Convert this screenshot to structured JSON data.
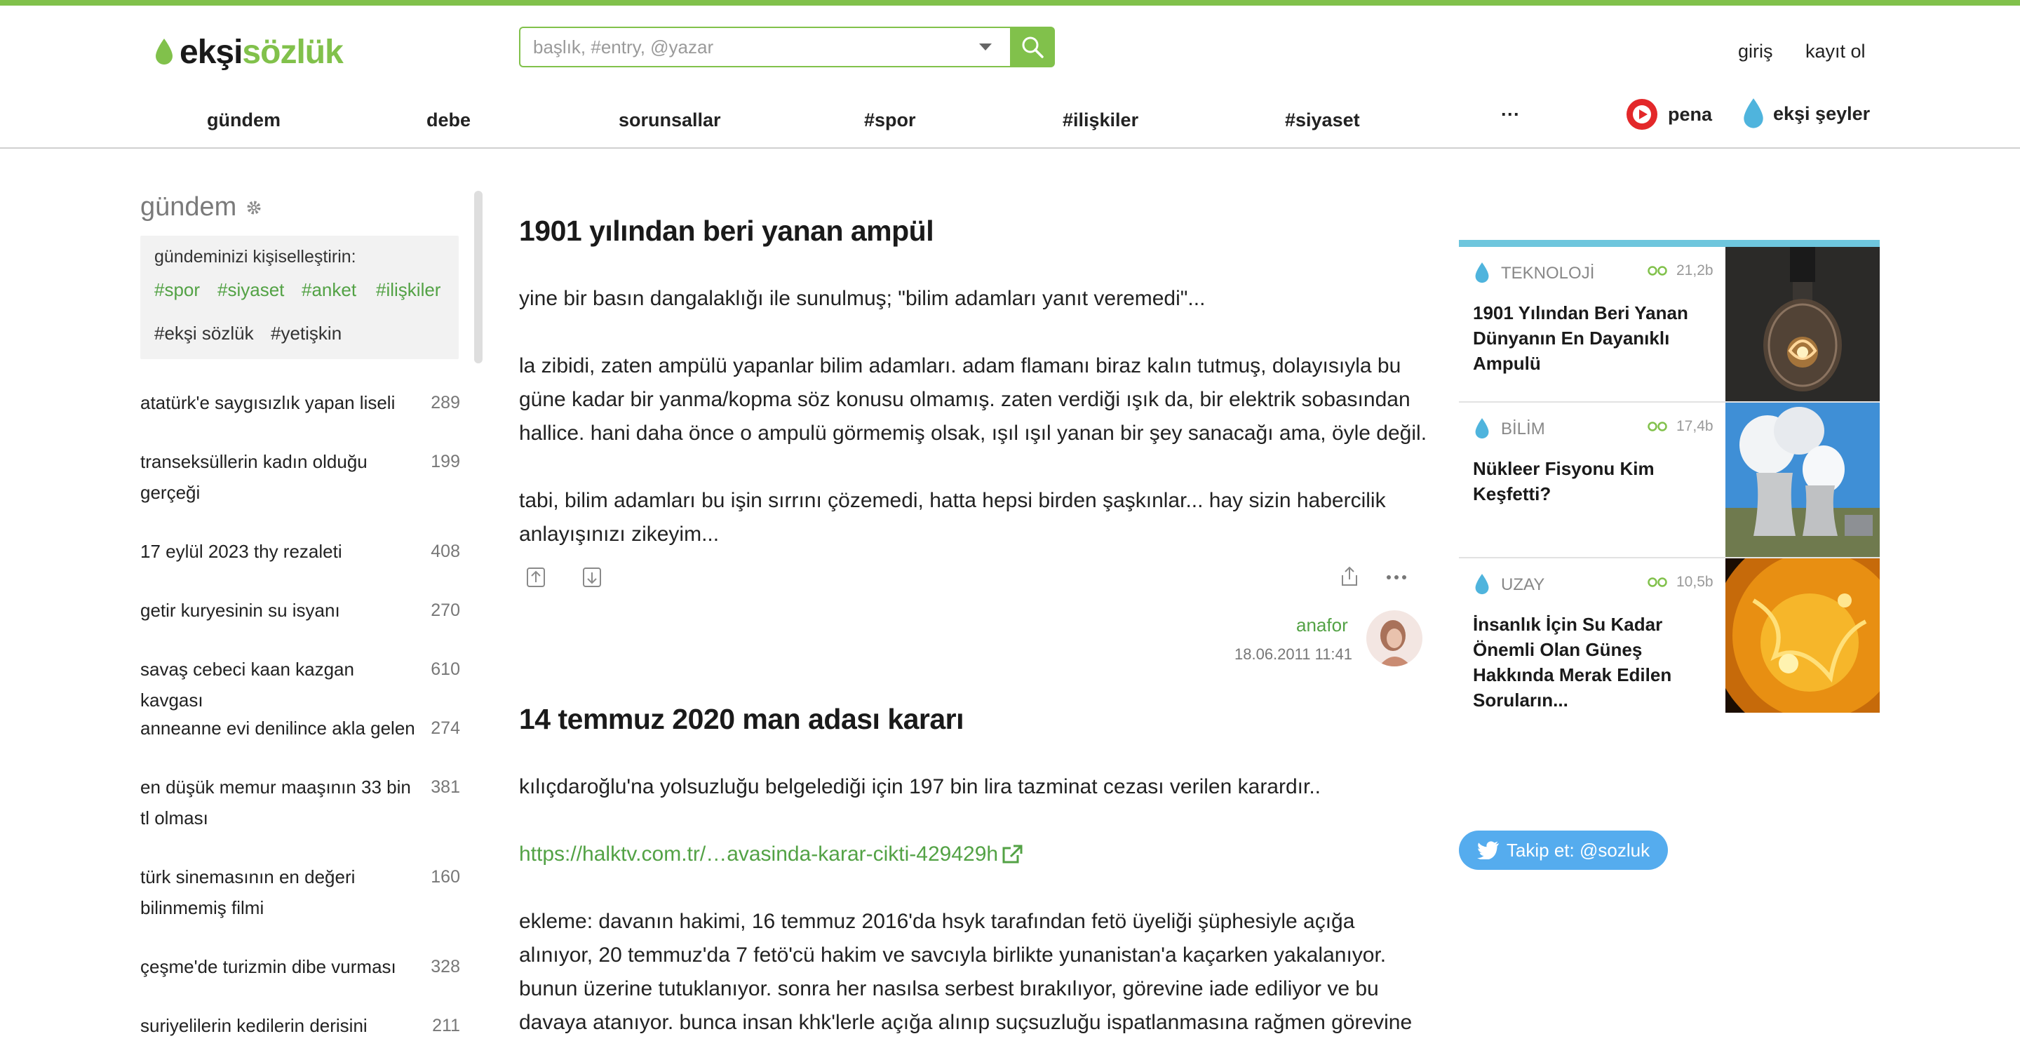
{
  "header": {
    "logo_part1": "ekşi",
    "logo_part2": "sözlük",
    "search_placeholder": "başlık, #entry, @yazar",
    "login": "giriş",
    "register": "kayıt ol"
  },
  "nav": {
    "items": [
      "gündem",
      "debe",
      "sorunsallar",
      "#spor",
      "#ilişkiler",
      "#siyaset",
      "···"
    ],
    "pena": "pena",
    "eksi_seyler": "ekşi şeyler"
  },
  "sidebar": {
    "title": "gündem",
    "customize_label": "gündeminizi kişiselleştirin:",
    "tags_green": [
      "#spor",
      "#siyaset",
      "#anket",
      "#ilişkiler"
    ],
    "tags_dark": [
      "#ekşi sözlük",
      "#yetişkin"
    ],
    "topics": [
      {
        "title": "atatürk'e saygısızlık yapan liseli",
        "count": "289"
      },
      {
        "title": "transeksüllerin kadın olduğu gerçeği",
        "count": "199"
      },
      {
        "title": "17 eylül 2023 thy rezaleti",
        "count": "408"
      },
      {
        "title": "getir kuryesinin su isyanı",
        "count": "270"
      },
      {
        "title": "savaş cebeci kaan kazgan kavgası",
        "count": "610"
      },
      {
        "title": "anneanne evi denilince akla gelen",
        "count": "274"
      },
      {
        "title": "en düşük memur maaşının 33 bin tl olması",
        "count": "381"
      },
      {
        "title": "türk sinemasının en değeri bilinmemiş filmi",
        "count": "160"
      },
      {
        "title": "çeşme'de turizmin dibe vurması",
        "count": "328"
      },
      {
        "title": "suriyelilerin kedilerin derisini",
        "count": "211"
      }
    ]
  },
  "entries": [
    {
      "title": "1901 yılından beri yanan ampül",
      "paragraphs": [
        "yine bir basın dangalaklığı ile sunulmuş; \"bilim adamları yanıt veremedi\"...",
        "la zibidi, zaten ampülü yapanlar bilim adamları. adam flamanı biraz kalın tutmuş, dolayısıyla bu güne kadar bir yanma/kopma söz konusu olmamış. zaten verdiği ışık da, bir elektrik sobasından hallice. hani daha önce o ampulü görmemiş olsak, ışıl ışıl yanan bir şey sanacağı ama, öyle değil.",
        "tabi, bilim adamları bu işin sırrını çözemedi, hatta hepsi birden şaşkınlar... hay sizin habercilik anlayışınızı zikeyim..."
      ],
      "author": "anafor",
      "date": "18.06.2011 11:41"
    },
    {
      "title": "14 temmuz 2020 man adası kararı",
      "paragraphs": [
        "kılıçdaroğlu'na yolsuzluğu belgelediği için 197 bin lira tazminat cezası verilen karardır..",
        "ekleme: davanın hakimi, 16 temmuz 2016'da hsyk tarafından fetö üyeliği şüphesiyle açığa alınıyor, 20 temmuz'da 7 fetö'cü hakim ve savcıyla birlikte yunanistan'a kaçarken yakalanıyor. bunun üzerine tutuklanıyor. sonra her nasılsa serbest bırakılıyor, görevine iade ediliyor ve bu davaya atanıyor. bunca insan khk'lerle açığa alınıp suçsuzluğu ispatlanmasına rağmen görevine"
      ],
      "link": "https://halktv.com.tr/…avasinda-karar-cikti-429429h"
    }
  ],
  "right_cards": [
    {
      "category": "TEKNOLOJİ",
      "count": "21,2b",
      "title": "1901 Yılından Beri Yanan Dünyanın En Dayanıklı Ampulü"
    },
    {
      "category": "BİLİM",
      "count": "17,4b",
      "title": "Nükleer Fisyonu Kim Keşfetti?"
    },
    {
      "category": "UZAY",
      "count": "10,5b",
      "title": "İnsanlık İçin Su Kadar Önemli Olan Güneş Hakkında Merak Edilen Soruların..."
    }
  ],
  "twitter": {
    "label": "Takip et: @sozluk"
  },
  "colors": {
    "brand": "#81c14b",
    "link": "#53a245",
    "accent_bar": "#6ec6dd",
    "twitter": "#55acee"
  }
}
